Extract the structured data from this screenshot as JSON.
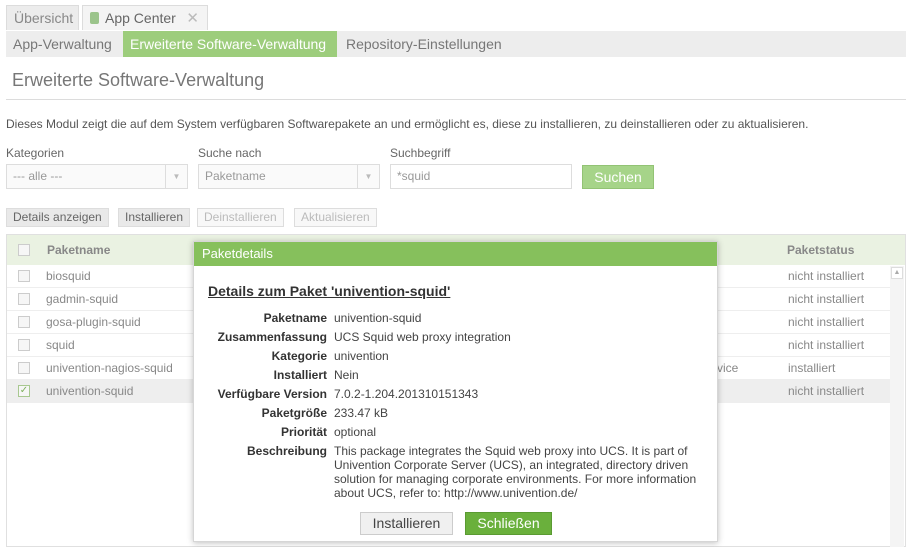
{
  "tabs": {
    "overview": "Übersicht",
    "app_center": "App Center",
    "close_symbol": "✕"
  },
  "subtabs": [
    "App-Verwaltung",
    "Erweiterte Software-Verwaltung",
    "Repository-Einstellungen"
  ],
  "page": {
    "title": "Erweiterte Software-Verwaltung",
    "description": "Dieses Modul zeigt die auf dem System verfügbaren Softwarepakete an und ermöglicht es, diese zu installieren, zu deinstallieren oder zu aktualisieren."
  },
  "filters": {
    "category_label": "Kategorien",
    "category_value": "--- alle ---",
    "search_by_label": "Suche nach",
    "search_by_value": "Paketname",
    "term_label": "Suchbegriff",
    "term_value": "*squid",
    "search_button": "Suchen"
  },
  "toolbar": {
    "details": "Details anzeigen",
    "install": "Installieren",
    "uninstall": "Deinstallieren",
    "update": "Aktualisieren"
  },
  "grid": {
    "headers": {
      "name": "Paketname",
      "status": "Paketstatus"
    },
    "rows": [
      {
        "name": "biosquid",
        "status": "nicht installiert",
        "desc_tail": "",
        "checked": false
      },
      {
        "name": "gadmin-squid",
        "status": "nicht installiert",
        "desc_tail": "",
        "checked": false
      },
      {
        "name": "gosa-plugin-squid",
        "status": "nicht installiert",
        "desc_tail": "",
        "checked": false
      },
      {
        "name": "squid",
        "status": "nicht installiert",
        "desc_tail": "",
        "checked": false
      },
      {
        "name": "univention-nagios-squid",
        "status": "installiert",
        "desc_tail": "vice",
        "checked": false
      },
      {
        "name": "univention-squid",
        "status": "nicht installiert",
        "desc_tail": "",
        "checked": true
      }
    ]
  },
  "dialog": {
    "title": "Paketdetails",
    "heading": "Details zum Paket 'univention-squid'",
    "fields": [
      {
        "label": "Paketname",
        "value": "univention-squid"
      },
      {
        "label": "Zusammenfassung",
        "value": "UCS Squid web proxy integration"
      },
      {
        "label": "Kategorie",
        "value": "univention"
      },
      {
        "label": "Installiert",
        "value": "Nein"
      },
      {
        "label": "Verfügbare Version",
        "value": "7.0.2-1.204.201310151343"
      },
      {
        "label": "Paketgröße",
        "value": "233.47 kB"
      },
      {
        "label": "Priorität",
        "value": "optional"
      },
      {
        "label": "Beschreibung",
        "value": "This package integrates the Squid web proxy into UCS. It is part of Univention Corporate Server (UCS), an integrated, directory driven solution for managing corporate environments. For more information about UCS, refer to: http://www.univention.de/"
      }
    ],
    "install_button": "Installieren",
    "close_button": "Schließen"
  }
}
